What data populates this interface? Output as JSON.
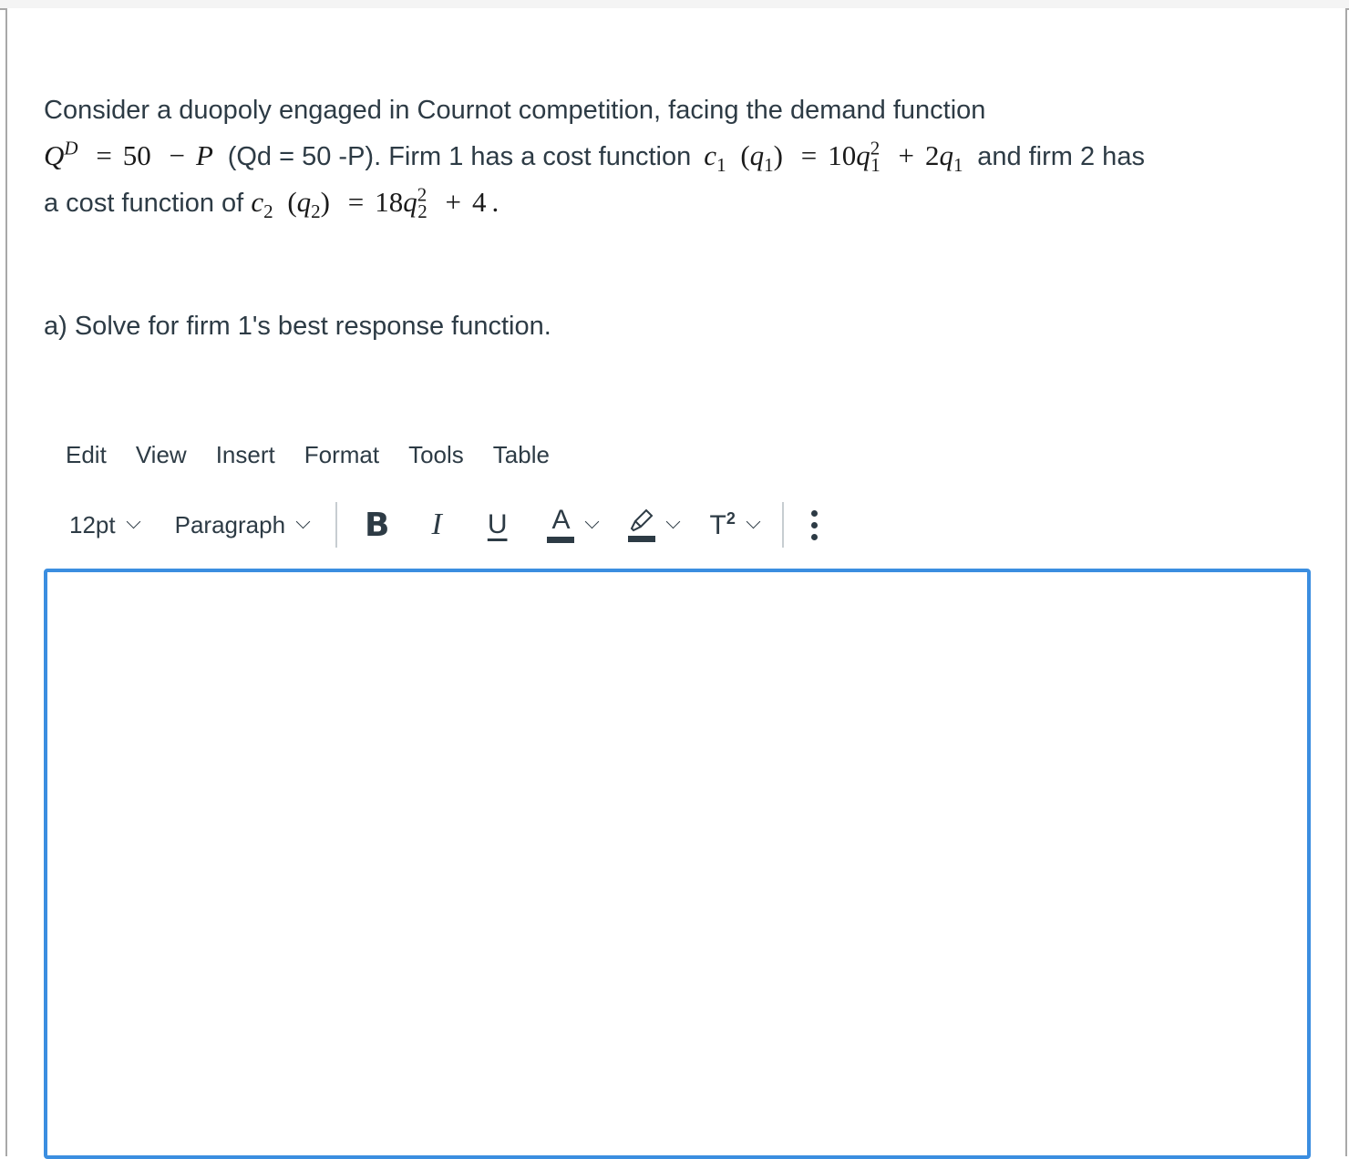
{
  "question": {
    "line1_text": "Consider a duopoly engaged in Cournot competition, facing the demand function",
    "demand_math": {
      "lhs_var": "Q",
      "lhs_sup": "D",
      "eq": "=",
      "const": "50",
      "minus": "−",
      "rhs_var": "P"
    },
    "demand_plain": "(Qd = 50 -P). Firm 1 has a cost function",
    "cost1_math": {
      "fn": "c",
      "fn_sub": "1",
      "arg_open": "(",
      "arg_var": "q",
      "arg_sub": "1",
      "arg_close": ")",
      "eq": "=",
      "coef": "10",
      "var": "q",
      "var_sub": "1",
      "var_sup": "2",
      "plus": "+",
      "coef2": "2",
      "var2": "q",
      "var2_sub": "1"
    },
    "mid_text": "and firm 2 has",
    "line3_text": "a cost function of",
    "cost2_math": {
      "fn": "c",
      "fn_sub": "2",
      "arg_open": "(",
      "arg_var": "q",
      "arg_sub": "2",
      "arg_close": ")",
      "eq": "=",
      "coef": "18",
      "var": "q",
      "var_sub": "2",
      "var_sup": "2",
      "plus": "+",
      "const": "4",
      "end": "."
    }
  },
  "subquestion": "a) Solve for firm 1's best response function.",
  "menubar": [
    "Edit",
    "View",
    "Insert",
    "Format",
    "Tools",
    "Table"
  ],
  "toolbar": {
    "font_size": "12pt",
    "block_format": "Paragraph",
    "bold": "B",
    "italic": "I",
    "underline": "U",
    "text_color": "A",
    "superscript_base": "T",
    "superscript_exp": "2"
  },
  "editor": {
    "content": ""
  },
  "colors": {
    "text": "#2d3b45",
    "editor_focus_border": "#3b8ee0",
    "frame_border": "#a9a9a9"
  }
}
